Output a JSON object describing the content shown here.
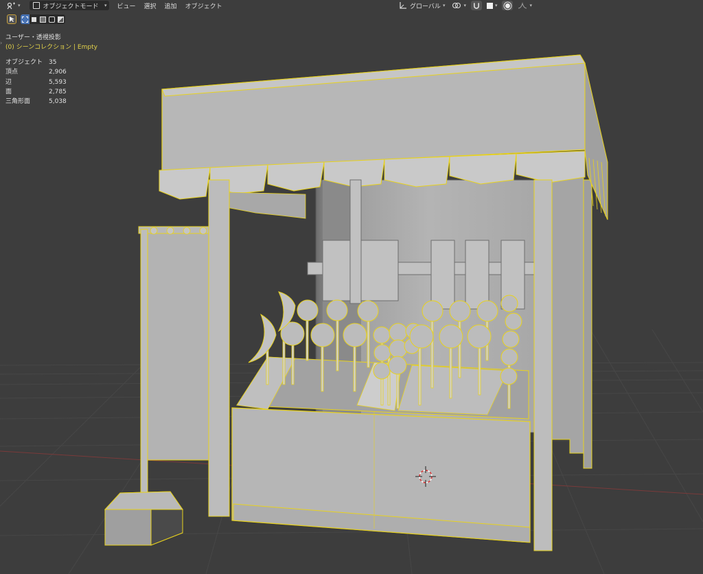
{
  "header": {
    "mode_label": "オブジェクトモード",
    "menus": [
      "ビュー",
      "選択",
      "追加",
      "オブジェクト"
    ],
    "transform_orientation": "グローバル"
  },
  "viewport": {
    "view_name": "ユーザー・透視投影",
    "collection_info": "(0) シーンコレクション | Empty",
    "stats": [
      {
        "label": "オブジェクト",
        "value": "35"
      },
      {
        "label": "頂点",
        "value": "2,906"
      },
      {
        "label": "辺",
        "value": "5,593"
      },
      {
        "label": "面",
        "value": "2,785"
      },
      {
        "label": "三角形面",
        "value": "5,038"
      }
    ]
  },
  "colors": {
    "background": "#3d3d3d",
    "header_button": "#2a2a2a",
    "selection_outline": "#e8d21d",
    "accent_blue": "#4772b3",
    "active_tool": "#5a5a5a",
    "model_gray": "#a9a9a9"
  },
  "icons": {
    "editor_type": "viewport-icon",
    "mode": "object-mode-icon",
    "orientation": "transform-orientation-icon",
    "pivot": "pivot-icon",
    "snap": "snap-magnet-icon",
    "proportional": "proportional-edit-icon",
    "falloff": "falloff-curve-icon"
  }
}
